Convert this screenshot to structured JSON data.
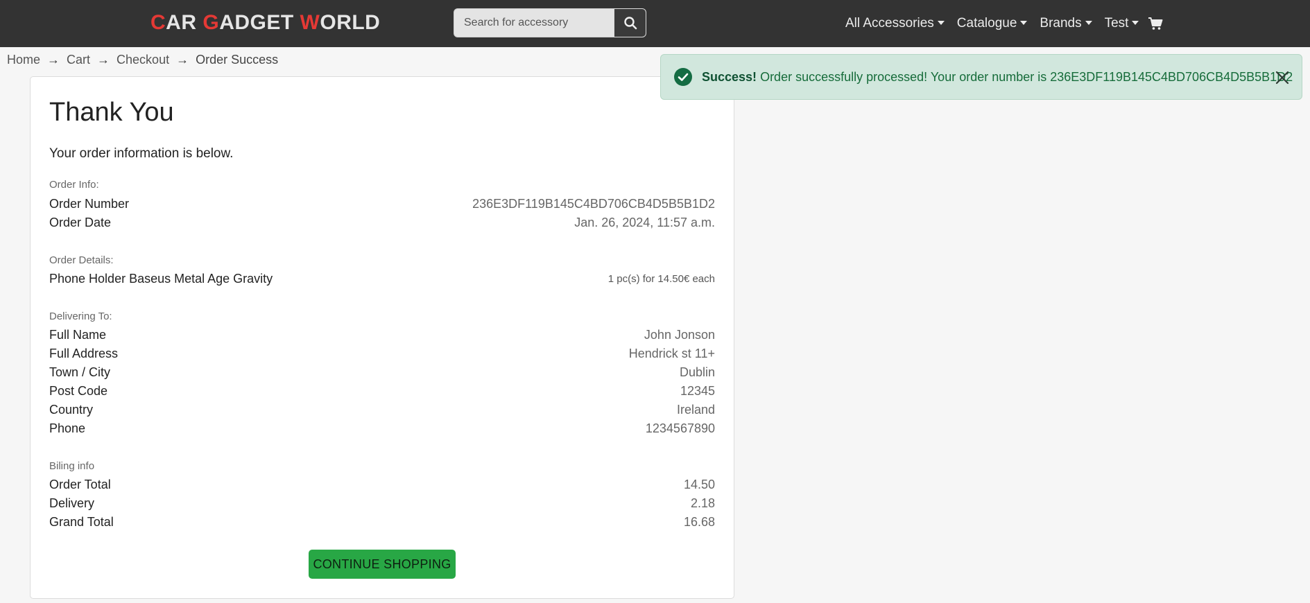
{
  "brand": {
    "parts": [
      {
        "text": "C",
        "accent": true
      },
      {
        "text": "AR ",
        "accent": false
      },
      {
        "text": "G",
        "accent": true
      },
      {
        "text": "ADGET ",
        "accent": false
      },
      {
        "text": "W",
        "accent": true
      },
      {
        "text": "ORLD",
        "accent": false
      }
    ],
    "accent_color": "#e53935"
  },
  "search": {
    "placeholder": "Search for accessory",
    "value": "",
    "icon": "search-icon"
  },
  "nav": {
    "items": [
      {
        "label": "All Accessories"
      },
      {
        "label": "Catalogue"
      },
      {
        "label": "Brands"
      },
      {
        "label": "Test"
      }
    ],
    "cart_icon": "cart-icon"
  },
  "breadcrumb": {
    "items": [
      "Home",
      "Cart",
      "Checkout",
      "Order Success"
    ],
    "separator": "→"
  },
  "alert": {
    "strong": "Success!",
    "message": "Order successfully processed! Your order number is 236E3DF119B145C4BD706CB4D5B5B1D2",
    "icon": "check-circle-icon",
    "close_icon": "close-icon",
    "color": "#d1e7dd"
  },
  "order": {
    "title": "Thank You",
    "intro": "Your order information is below.",
    "info": {
      "label": "Order Info:",
      "number_label": "Order Number",
      "number": "236E3DF119B145C4BD706CB4D5B5B1D2",
      "date_label": "Order Date",
      "date": "Jan. 26, 2024, 11:57 a.m."
    },
    "details": {
      "label": "Order Details:",
      "items": [
        {
          "name": "Phone Holder Baseus Metal Age Gravity",
          "qty_text": "1 pc(s) for 14.50€ each"
        }
      ]
    },
    "delivery": {
      "label": "Delivering To:",
      "full_name_label": "Full Name",
      "full_name": "John Jonson",
      "address_label": "Full Address",
      "address": "Hendrick st 11+",
      "town_label": "Town / City",
      "town": "Dublin",
      "postcode_label": "Post Code",
      "postcode": "12345",
      "country_label": "Country",
      "country": "Ireland",
      "phone_label": "Phone",
      "phone": "1234567890"
    },
    "billing": {
      "label": "Biling info",
      "order_total_label": "Order Total",
      "order_total": "14.50",
      "delivery_label": "Delivery",
      "delivery": "2.18",
      "grand_total_label": "Grand Total",
      "grand_total": "16.68"
    },
    "continue_label": "CONTINUE SHOPPING",
    "continue_color": "#28a745"
  }
}
